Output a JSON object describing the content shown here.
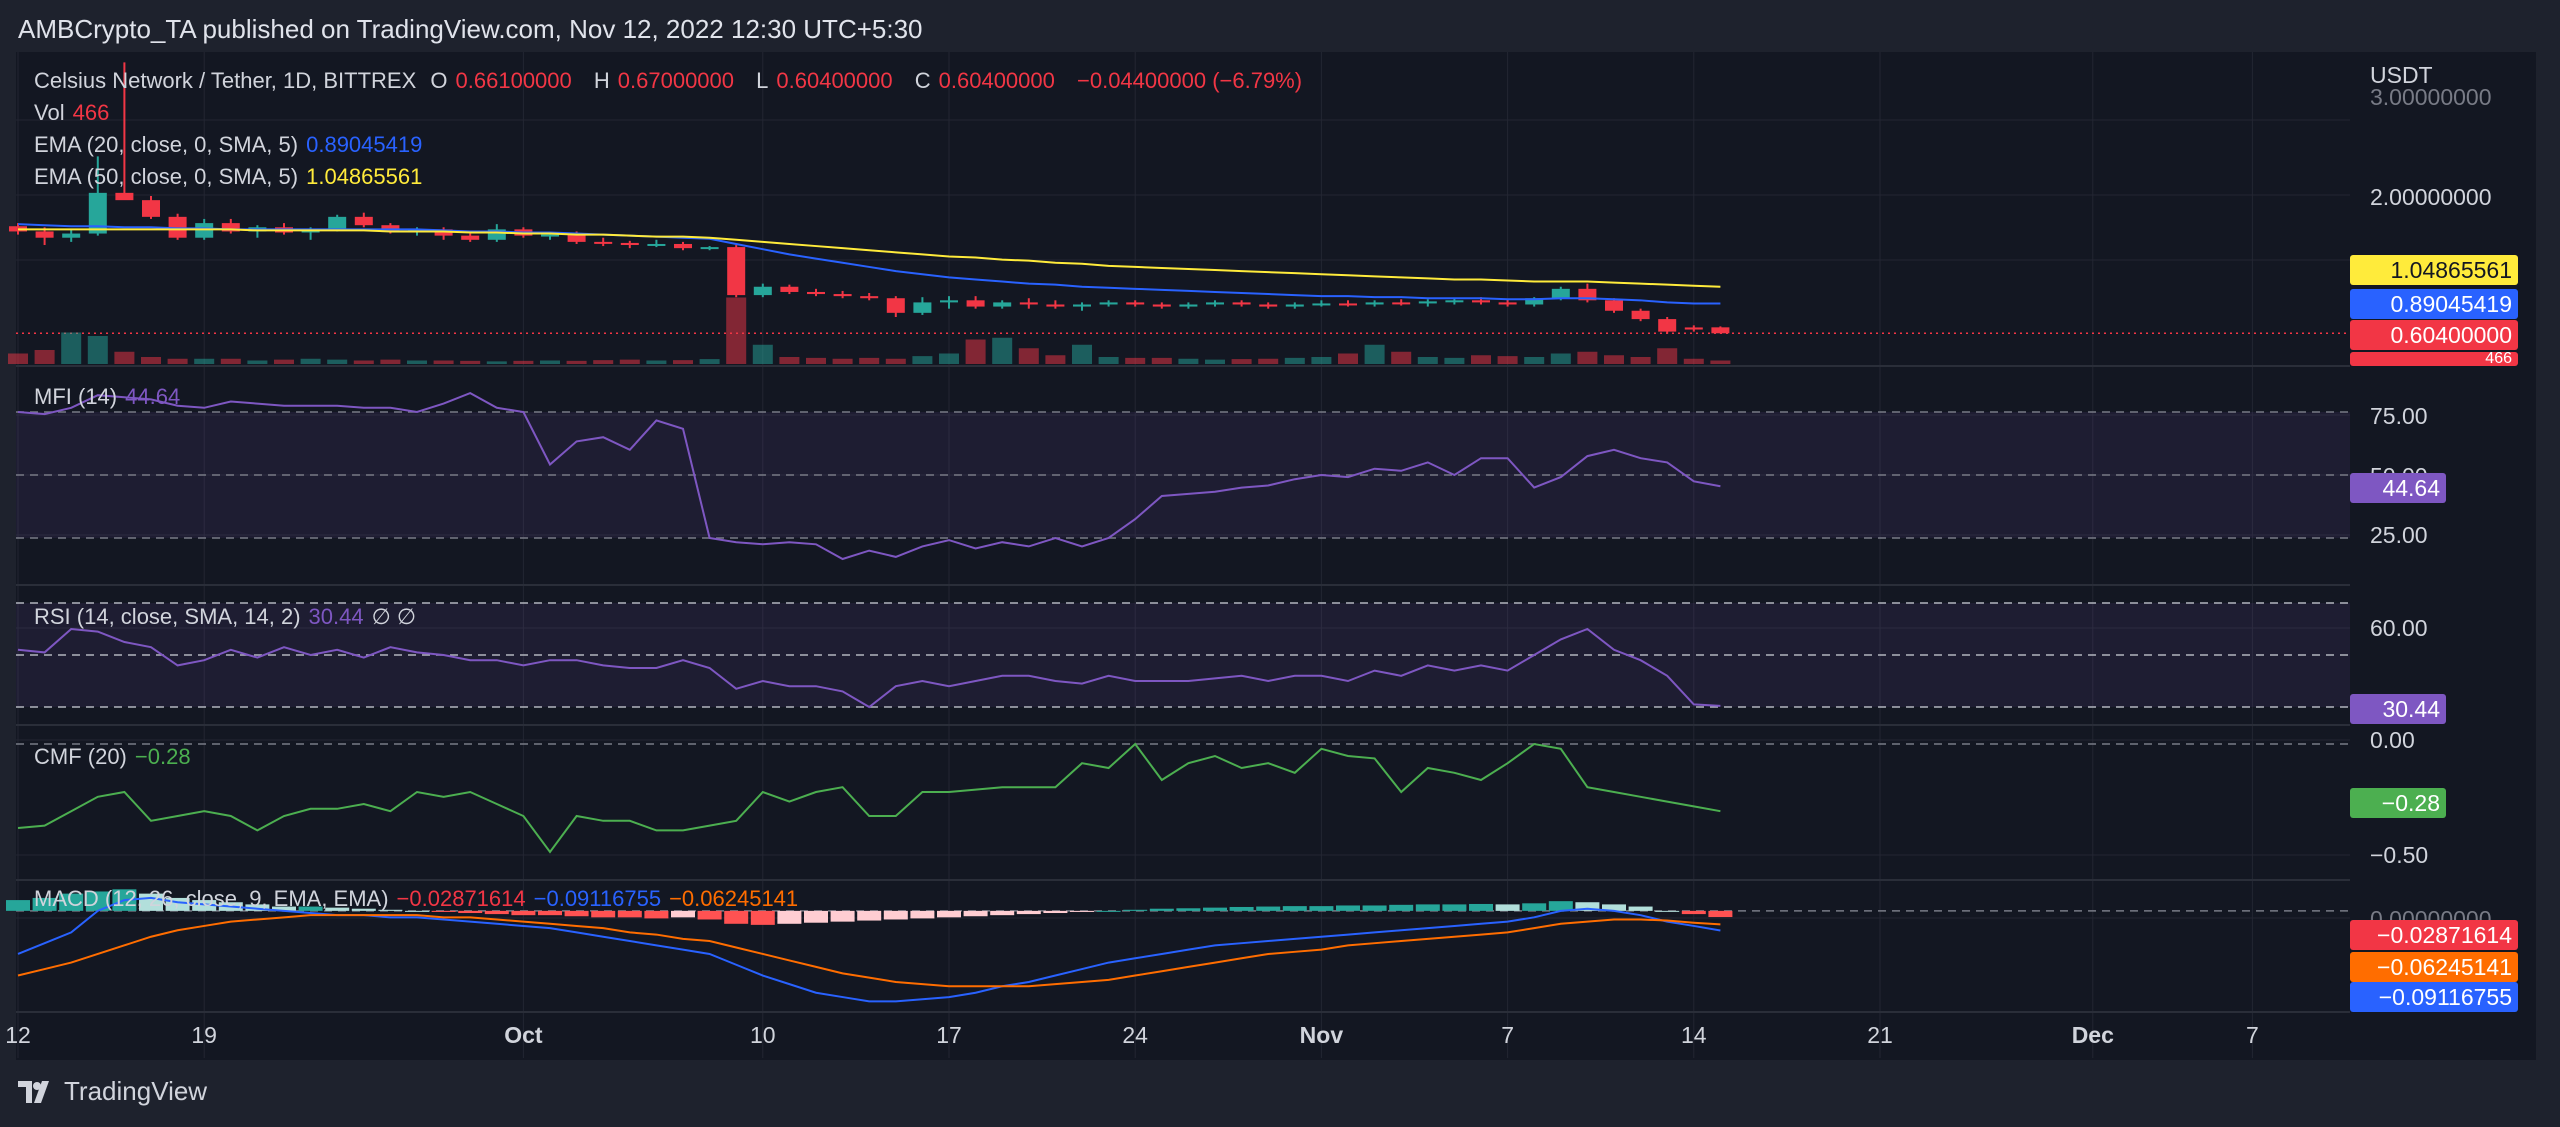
{
  "header": "AMBCrypto_TA published on TradingView.com, Nov 12, 2022 12:30 UTC+5:30",
  "footer": "TradingView",
  "price_axis_label": "USDT",
  "legend": {
    "symbol": "Celsius Network / Tether, 1D, BITTREX",
    "o_label": "O",
    "o_val": "0.66100000",
    "h_label": "H",
    "h_val": "0.67000000",
    "l_label": "L",
    "l_val": "0.60400000",
    "c_label": "C",
    "c_val": "0.60400000",
    "change": "−0.04400000 (−6.79%)",
    "vol_label": "Vol",
    "vol_val": "466",
    "ema20_label": "EMA (20, close, 0, SMA, 5)",
    "ema20_val": "0.89045419",
    "ema50_label": "EMA (50, close, 0, SMA, 5)",
    "ema50_val": "1.04865561",
    "mfi_label": "MFI (14)",
    "mfi_val": "44.64",
    "rsi_label": "RSI (14, close, SMA, 14, 2)",
    "rsi_val": "30.44",
    "rsi_extra": "∅  ∅",
    "cmf_label": "CMF (20)",
    "cmf_val": "−0.28",
    "macd_label": "MACD (12, 26, close, 9, EMA, EMA)",
    "macd_hist": "−0.02871614",
    "macd_line": "−0.09116755",
    "macd_signal": "−0.06245141"
  },
  "axis_ticks": {
    "price": [
      "3.00000000",
      "2.00000000"
    ],
    "mfi": [
      "75.00",
      "50.00",
      "25.00"
    ],
    "rsi": [
      "60.00"
    ],
    "cmf": [
      "0.00",
      "−0.50"
    ],
    "macd": [
      "0.00000000"
    ]
  },
  "price_tags": [
    {
      "text": "1.04865561",
      "bg": "#ffeb3b",
      "fg": "#131722"
    },
    {
      "text": "0.89045419",
      "bg": "#2962ff",
      "fg": "#ffffff"
    },
    {
      "text": "0.60400000",
      "bg": "#f23645",
      "fg": "#ffffff"
    },
    {
      "text": "466",
      "bg": "#f23645",
      "fg": "#ffffff"
    }
  ],
  "indicator_tags": {
    "mfi": {
      "text": "44.64",
      "bg": "#7e57c2",
      "fg": "#ffffff"
    },
    "rsi": {
      "text": "30.44",
      "bg": "#7e57c2",
      "fg": "#ffffff"
    },
    "cmf": {
      "text": "−0.28",
      "bg": "#4caf50",
      "fg": "#ffffff"
    },
    "macd": [
      {
        "text": "−0.02871614",
        "bg": "#f23645",
        "fg": "#ffffff"
      },
      {
        "text": "−0.06245141",
        "bg": "#ff6d00",
        "fg": "#ffffff"
      },
      {
        "text": "−0.09116755",
        "bg": "#2962ff",
        "fg": "#ffffff"
      }
    ]
  },
  "x_ticks": [
    "12",
    "19",
    "Oct",
    "10",
    "17",
    "24",
    "Nov",
    "7",
    "14",
    "21",
    "Dec",
    "7"
  ],
  "colors": {
    "up": "#26a69a",
    "down": "#f23645",
    "ema20": "#2962ff",
    "ema50": "#ffeb3b",
    "mfi": "#7e57c2",
    "rsi": "#7e57c2",
    "cmf": "#4caf50",
    "macd": "#2962ff",
    "signal": "#ff6d00"
  },
  "chart_data": {
    "type": "candlestick",
    "title": "Celsius Network / Tether, 1D, BITTREX",
    "x_start": "2022-09-12",
    "x_range": [
      "2022-09-12",
      "2022-12-10"
    ],
    "price_ylim": [
      0.3,
      3.3
    ],
    "candles": [
      [
        1.63,
        1.66,
        1.55,
        1.58
      ],
      [
        1.58,
        1.62,
        1.45,
        1.52
      ],
      [
        1.52,
        1.6,
        1.48,
        1.56
      ],
      [
        1.56,
        2.3,
        1.54,
        1.95
      ],
      [
        1.95,
        3.2,
        1.9,
        1.88
      ],
      [
        1.88,
        1.92,
        1.7,
        1.72
      ],
      [
        1.72,
        1.75,
        1.5,
        1.52
      ],
      [
        1.52,
        1.7,
        1.5,
        1.66
      ],
      [
        1.66,
        1.7,
        1.56,
        1.58
      ],
      [
        1.58,
        1.64,
        1.52,
        1.62
      ],
      [
        1.62,
        1.66,
        1.55,
        1.57
      ],
      [
        1.57,
        1.62,
        1.5,
        1.6
      ],
      [
        1.6,
        1.74,
        1.58,
        1.72
      ],
      [
        1.72,
        1.76,
        1.62,
        1.64
      ],
      [
        1.64,
        1.66,
        1.56,
        1.58
      ],
      [
        1.58,
        1.62,
        1.54,
        1.6
      ],
      [
        1.6,
        1.62,
        1.5,
        1.54
      ],
      [
        1.54,
        1.56,
        1.48,
        1.5
      ],
      [
        1.5,
        1.65,
        1.48,
        1.6
      ],
      [
        1.6,
        1.62,
        1.52,
        1.54
      ],
      [
        1.54,
        1.56,
        1.5,
        1.55
      ],
      [
        1.55,
        1.58,
        1.46,
        1.48
      ],
      [
        1.48,
        1.52,
        1.44,
        1.47
      ],
      [
        1.47,
        1.49,
        1.42,
        1.45
      ],
      [
        1.45,
        1.5,
        1.43,
        1.46
      ],
      [
        1.46,
        1.48,
        1.4,
        1.42
      ],
      [
        1.42,
        1.44,
        1.4,
        1.43
      ],
      [
        1.43,
        1.45,
        0.95,
        0.97
      ],
      [
        0.97,
        1.08,
        0.95,
        1.05
      ],
      [
        1.05,
        1.07,
        0.98,
        1.0
      ],
      [
        1.0,
        1.03,
        0.96,
        0.98
      ],
      [
        0.98,
        1.01,
        0.94,
        0.96
      ],
      [
        0.96,
        0.99,
        0.92,
        0.94
      ],
      [
        0.94,
        0.96,
        0.76,
        0.8
      ],
      [
        0.8,
        0.95,
        0.78,
        0.9
      ],
      [
        0.9,
        0.96,
        0.84,
        0.92
      ],
      [
        0.92,
        0.96,
        0.84,
        0.86
      ],
      [
        0.86,
        0.92,
        0.84,
        0.9
      ],
      [
        0.9,
        0.94,
        0.84,
        0.88
      ],
      [
        0.88,
        0.92,
        0.84,
        0.86
      ],
      [
        0.86,
        0.9,
        0.82,
        0.88
      ],
      [
        0.88,
        0.92,
        0.86,
        0.9
      ],
      [
        0.9,
        0.92,
        0.86,
        0.88
      ],
      [
        0.88,
        0.9,
        0.84,
        0.86
      ],
      [
        0.86,
        0.9,
        0.84,
        0.88
      ],
      [
        0.88,
        0.92,
        0.86,
        0.9
      ],
      [
        0.9,
        0.92,
        0.86,
        0.88
      ],
      [
        0.88,
        0.9,
        0.84,
        0.86
      ],
      [
        0.86,
        0.9,
        0.84,
        0.88
      ],
      [
        0.88,
        0.92,
        0.86,
        0.89
      ],
      [
        0.89,
        0.92,
        0.86,
        0.88
      ],
      [
        0.88,
        0.92,
        0.86,
        0.9
      ],
      [
        0.9,
        0.93,
        0.87,
        0.89
      ],
      [
        0.89,
        0.93,
        0.86,
        0.91
      ],
      [
        0.91,
        0.94,
        0.88,
        0.92
      ],
      [
        0.92,
        0.95,
        0.88,
        0.9
      ],
      [
        0.9,
        0.93,
        0.86,
        0.88
      ],
      [
        0.88,
        0.95,
        0.86,
        0.94
      ],
      [
        0.94,
        1.05,
        0.92,
        1.03
      ],
      [
        1.03,
        1.08,
        0.9,
        0.92
      ],
      [
        0.92,
        0.94,
        0.8,
        0.82
      ],
      [
        0.82,
        0.84,
        0.72,
        0.74
      ],
      [
        0.74,
        0.76,
        0.6,
        0.62
      ],
      [
        0.66,
        0.68,
        0.62,
        0.64
      ],
      [
        0.661,
        0.67,
        0.604,
        0.604
      ]
    ],
    "volume": [
      60,
      80,
      180,
      160,
      70,
      40,
      30,
      30,
      30,
      20,
      25,
      30,
      25,
      20,
      25,
      20,
      20,
      18,
      15,
      18,
      20,
      18,
      22,
      25,
      20,
      22,
      28,
      380,
      110,
      40,
      35,
      30,
      35,
      30,
      45,
      60,
      140,
      150,
      90,
      50,
      110,
      40,
      35,
      35,
      30,
      25,
      28,
      30,
      35,
      40,
      60,
      110,
      70,
      40,
      35,
      50,
      45,
      40,
      60,
      70,
      50,
      40,
      90,
      30,
      20
    ],
    "ema20": [
      1.65,
      1.64,
      1.63,
      1.63,
      1.62,
      1.62,
      1.61,
      1.61,
      1.6,
      1.6,
      1.6,
      1.6,
      1.6,
      1.6,
      1.6,
      1.6,
      1.59,
      1.58,
      1.58,
      1.57,
      1.57,
      1.56,
      1.55,
      1.54,
      1.53,
      1.52,
      1.51,
      1.46,
      1.41,
      1.36,
      1.32,
      1.28,
      1.24,
      1.2,
      1.17,
      1.14,
      1.12,
      1.1,
      1.08,
      1.07,
      1.05,
      1.04,
      1.03,
      1.02,
      1.01,
      1.0,
      0.99,
      0.98,
      0.97,
      0.96,
      0.96,
      0.95,
      0.95,
      0.94,
      0.94,
      0.94,
      0.93,
      0.93,
      0.94,
      0.94,
      0.93,
      0.92,
      0.9,
      0.89,
      0.89
    ],
    "ema50": [
      1.6,
      1.6,
      1.6,
      1.6,
      1.6,
      1.6,
      1.6,
      1.6,
      1.6,
      1.59,
      1.59,
      1.59,
      1.59,
      1.59,
      1.58,
      1.58,
      1.58,
      1.57,
      1.57,
      1.56,
      1.56,
      1.55,
      1.55,
      1.54,
      1.53,
      1.53,
      1.52,
      1.5,
      1.48,
      1.46,
      1.44,
      1.42,
      1.4,
      1.38,
      1.36,
      1.34,
      1.33,
      1.31,
      1.3,
      1.28,
      1.27,
      1.25,
      1.24,
      1.23,
      1.22,
      1.21,
      1.2,
      1.19,
      1.18,
      1.17,
      1.16,
      1.15,
      1.14,
      1.13,
      1.12,
      1.12,
      1.11,
      1.1,
      1.1,
      1.1,
      1.09,
      1.08,
      1.07,
      1.06,
      1.05
    ],
    "mfi": [
      80,
      79,
      82,
      88,
      87,
      86,
      83,
      82,
      85,
      84,
      83,
      83,
      83,
      82,
      82,
      80,
      84,
      89,
      82,
      80,
      55,
      66,
      68,
      62,
      76,
      72,
      20,
      18,
      17,
      18,
      17,
      10,
      14,
      11,
      16,
      19,
      15,
      18,
      16,
      20,
      16,
      20,
      29,
      40,
      41,
      42,
      44,
      45,
      48,
      50,
      49,
      53,
      52,
      56,
      50,
      58,
      58,
      44,
      49,
      59,
      62,
      58,
      56,
      47,
      44.64
    ],
    "rsi": [
      52,
      51,
      60,
      59,
      55,
      53,
      46,
      48,
      52,
      49,
      53,
      50,
      52,
      49,
      53,
      51,
      50,
      48,
      48,
      46,
      48,
      48,
      46,
      45,
      45,
      48,
      45,
      37,
      40,
      38,
      38,
      36,
      30,
      38,
      40,
      38,
      40,
      42,
      42,
      40,
      39,
      42,
      40,
      40,
      40,
      41,
      42,
      40,
      42,
      42,
      40,
      44,
      42,
      46,
      44,
      46,
      44,
      50,
      56,
      60,
      52,
      48,
      42,
      31,
      30.44
    ],
    "cmf": [
      -0.35,
      -0.34,
      -0.28,
      -0.22,
      -0.2,
      -0.32,
      -0.3,
      -0.28,
      -0.3,
      -0.36,
      -0.3,
      -0.27,
      -0.27,
      -0.25,
      -0.28,
      -0.2,
      -0.22,
      -0.2,
      -0.25,
      -0.3,
      -0.45,
      -0.3,
      -0.32,
      -0.32,
      -0.36,
      -0.36,
      -0.34,
      -0.32,
      -0.2,
      -0.24,
      -0.2,
      -0.18,
      -0.3,
      -0.3,
      -0.2,
      -0.2,
      -0.19,
      -0.18,
      -0.18,
      -0.18,
      -0.08,
      -0.1,
      0.0,
      -0.15,
      -0.08,
      -0.05,
      -0.1,
      -0.08,
      -0.12,
      -0.02,
      -0.05,
      -0.06,
      -0.2,
      -0.1,
      -0.12,
      -0.15,
      -0.08,
      0.0,
      -0.02,
      -0.18,
      -0.2,
      -0.22,
      -0.24,
      -0.26,
      -0.28
    ],
    "macd_hist": [
      0.05,
      0.06,
      0.08,
      0.09,
      0.1,
      0.08,
      0.06,
      0.05,
      0.04,
      0.03,
      0.02,
      0.02,
      0.015,
      0.01,
      0.005,
      0.0,
      -0.005,
      -0.01,
      -0.015,
      -0.02,
      -0.02,
      -0.025,
      -0.03,
      -0.03,
      -0.035,
      -0.03,
      -0.04,
      -0.06,
      -0.065,
      -0.06,
      -0.055,
      -0.05,
      -0.045,
      -0.04,
      -0.035,
      -0.03,
      -0.025,
      -0.02,
      -0.015,
      -0.01,
      -0.005,
      0.0,
      0.005,
      0.01,
      0.012,
      0.015,
      0.018,
      0.02,
      0.022,
      0.022,
      0.025,
      0.025,
      0.028,
      0.03,
      0.03,
      0.032,
      0.03,
      0.035,
      0.045,
      0.04,
      0.03,
      0.02,
      0.0,
      -0.015,
      -0.0287
    ],
    "macd_line": [
      -0.2,
      -0.15,
      -0.1,
      0.0,
      0.05,
      0.06,
      0.04,
      0.03,
      0.02,
      0.01,
      0.0,
      -0.01,
      -0.02,
      -0.02,
      -0.03,
      -0.03,
      -0.04,
      -0.05,
      -0.06,
      -0.07,
      -0.08,
      -0.1,
      -0.12,
      -0.14,
      -0.16,
      -0.18,
      -0.2,
      -0.25,
      -0.3,
      -0.34,
      -0.38,
      -0.4,
      -0.42,
      -0.42,
      -0.41,
      -0.4,
      -0.38,
      -0.35,
      -0.33,
      -0.3,
      -0.27,
      -0.24,
      -0.22,
      -0.2,
      -0.18,
      -0.16,
      -0.15,
      -0.14,
      -0.13,
      -0.12,
      -0.11,
      -0.1,
      -0.09,
      -0.08,
      -0.07,
      -0.06,
      -0.05,
      -0.03,
      0.0,
      0.01,
      0.0,
      -0.02,
      -0.05,
      -0.07,
      -0.0912
    ],
    "macd_signal": [
      -0.3,
      -0.27,
      -0.24,
      -0.2,
      -0.16,
      -0.12,
      -0.09,
      -0.07,
      -0.05,
      -0.04,
      -0.03,
      -0.02,
      -0.02,
      -0.02,
      -0.02,
      -0.02,
      -0.03,
      -0.03,
      -0.04,
      -0.05,
      -0.06,
      -0.07,
      -0.08,
      -0.1,
      -0.11,
      -0.13,
      -0.14,
      -0.17,
      -0.2,
      -0.23,
      -0.26,
      -0.29,
      -0.31,
      -0.33,
      -0.34,
      -0.35,
      -0.35,
      -0.35,
      -0.35,
      -0.34,
      -0.33,
      -0.32,
      -0.3,
      -0.28,
      -0.26,
      -0.24,
      -0.22,
      -0.2,
      -0.19,
      -0.18,
      -0.16,
      -0.15,
      -0.14,
      -0.13,
      -0.12,
      -0.11,
      -0.1,
      -0.08,
      -0.06,
      -0.05,
      -0.04,
      -0.04,
      -0.045,
      -0.055,
      -0.0625
    ]
  }
}
